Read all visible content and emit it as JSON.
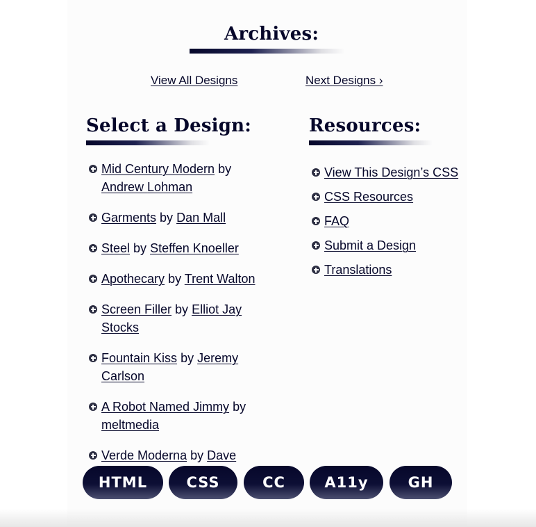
{
  "archives": {
    "title": "Archives:",
    "view_all": "View All Designs",
    "next": "Next Designs ›"
  },
  "designs": {
    "title": "Select a Design:",
    "items": [
      {
        "design": "Mid Century Modern",
        "by": "by",
        "author_a": "Andrew",
        "author_b": "Lohman"
      },
      {
        "design": "Garments",
        "by": "by",
        "author": "Dan Mall"
      },
      {
        "design": "Steel",
        "by": "by",
        "author": "Steffen Knoeller"
      },
      {
        "design": "Apothecary",
        "by": "by",
        "author": "Trent Walton"
      },
      {
        "design": "Screen Filler",
        "by": "by",
        "author": "Elliot Jay Stocks"
      },
      {
        "design": "Fountain Kiss",
        "by": "by",
        "author": "Jeremy Carlson"
      },
      {
        "design": "A Robot Named Jimmy",
        "by": "by",
        "author": "meltmedia"
      },
      {
        "design": "Verde Moderna",
        "by": "by",
        "author": "Dave Shea"
      }
    ]
  },
  "resources": {
    "title": "Resources:",
    "items": [
      "View This Design’s CSS",
      "CSS Resources",
      "FAQ",
      "Submit a Design",
      "Translations"
    ]
  },
  "badges": [
    "HTML",
    "CSS",
    "CC",
    "A11y",
    "GH"
  ],
  "colors": {
    "text": "#06072a",
    "panel_background": "#fcfcfc",
    "badge_top": "#06072a",
    "badge_bottom": "#4c5071"
  }
}
